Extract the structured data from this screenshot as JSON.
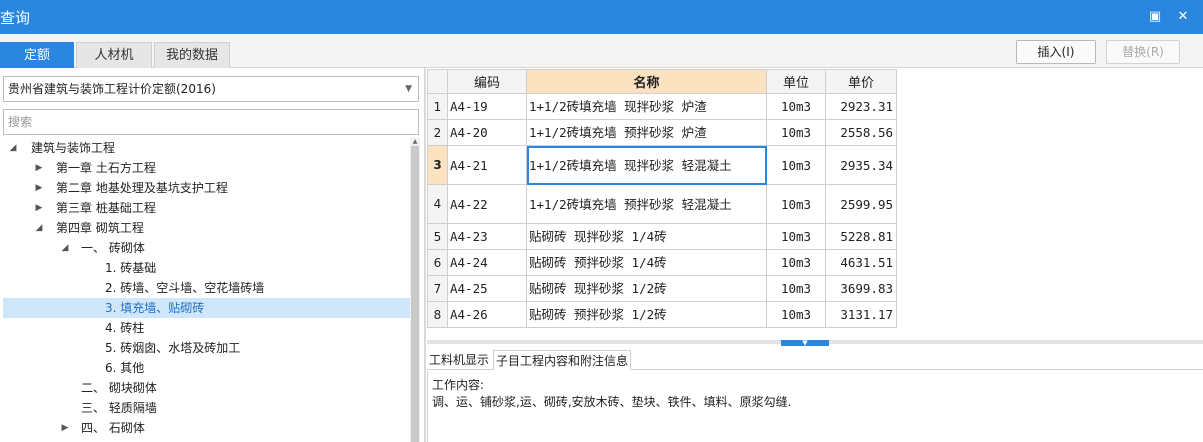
{
  "window": {
    "title": "查询",
    "maximize_glyph": "▣",
    "close_glyph": "✕"
  },
  "tabs": [
    "定额",
    "人材机",
    "我的数据"
  ],
  "toolbar": {
    "insert_label": "插入(I)",
    "replace_label": "替换(R)"
  },
  "quota_library": {
    "selected": "贵州省建筑与装饰工程计价定额(2016)"
  },
  "search": {
    "placeholder": "搜索"
  },
  "tree": [
    {
      "label": "建筑与装饰工程",
      "state": "expanded"
    },
    {
      "label": "第一章 土石方工程",
      "state": "collapsed"
    },
    {
      "label": "第二章 地基处理及基坑支护工程",
      "state": "collapsed"
    },
    {
      "label": "第三章 桩基础工程",
      "state": "collapsed"
    },
    {
      "label": "第四章 砌筑工程",
      "state": "expanded"
    },
    {
      "label": "一、 砖砌体",
      "state": "expanded"
    },
    {
      "label": "1. 砖基础",
      "state": "leaf"
    },
    {
      "label": "2. 砖墙、空斗墙、空花墙砖墙",
      "state": "leaf"
    },
    {
      "label": "3. 填充墙、贴砌砖",
      "state": "leaf",
      "selected": true
    },
    {
      "label": "4. 砖柱",
      "state": "leaf"
    },
    {
      "label": "5. 砖烟囱、水塔及砖加工",
      "state": "leaf"
    },
    {
      "label": "6. 其他",
      "state": "leaf"
    },
    {
      "label": "二、 砌块砌体",
      "state": "leaf"
    },
    {
      "label": "三、 轻质隔墙",
      "state": "leaf"
    },
    {
      "label": "四、 石砌体",
      "state": "collapsed"
    }
  ],
  "grid": {
    "headers": {
      "code": "编码",
      "name": "名称",
      "unit": "单位",
      "price": "单价"
    },
    "rows": [
      {
        "idx": "1",
        "code": "A4-19",
        "name": "1+1/2砖填充墙 现拌砂浆 炉渣",
        "unit": "10m3",
        "price": "2923.31"
      },
      {
        "idx": "2",
        "code": "A4-20",
        "name": "1+1/2砖填充墙 预拌砂浆 炉渣",
        "unit": "10m3",
        "price": "2558.56"
      },
      {
        "idx": "3",
        "code": "A4-21",
        "name": "1+1/2砖填充墙 现拌砂浆 轻混凝土",
        "unit": "10m3",
        "price": "2935.34"
      },
      {
        "idx": "4",
        "code": "A4-22",
        "name": "1+1/2砖填充墙 预拌砂浆 轻混凝土",
        "unit": "10m3",
        "price": "2599.95"
      },
      {
        "idx": "5",
        "code": "A4-23",
        "name": "贴砌砖 现拌砂浆 1/4砖",
        "unit": "10m3",
        "price": "5228.81"
      },
      {
        "idx": "6",
        "code": "A4-24",
        "name": "贴砌砖 预拌砂浆 1/4砖",
        "unit": "10m3",
        "price": "4631.51"
      },
      {
        "idx": "7",
        "code": "A4-25",
        "name": "贴砌砖 现拌砂浆 1/2砖",
        "unit": "10m3",
        "price": "3699.83"
      },
      {
        "idx": "8",
        "code": "A4-26",
        "name": "贴砌砖 预拌砂浆 1/2砖",
        "unit": "10m3",
        "price": "3131.17"
      }
    ]
  },
  "detail_tabs": [
    "工料机显示",
    "子目工程内容和附注信息"
  ],
  "detail": {
    "heading": "工作内容:",
    "text": "调、运、铺砂浆,运、砌砖,安放木砖、垫块、铁件、填料、原浆勾缝."
  }
}
